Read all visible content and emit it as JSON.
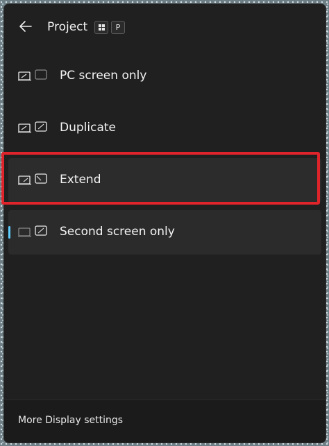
{
  "header": {
    "title": "Project",
    "shortcut_win_key": "windows-key",
    "shortcut_letter": "P"
  },
  "options": [
    {
      "label": "PC screen only",
      "icon": "pc-screen-only-icon"
    },
    {
      "label": "Duplicate",
      "icon": "duplicate-icon"
    },
    {
      "label": "Extend",
      "icon": "extend-icon",
      "highlighted": true
    },
    {
      "label": "Second screen only",
      "icon": "second-screen-only-icon",
      "selected": true
    }
  ],
  "footer": {
    "link": "More Display settings"
  },
  "colors": {
    "panel": "#202020",
    "accent": "#60cdff",
    "highlight": "#e0242b"
  }
}
